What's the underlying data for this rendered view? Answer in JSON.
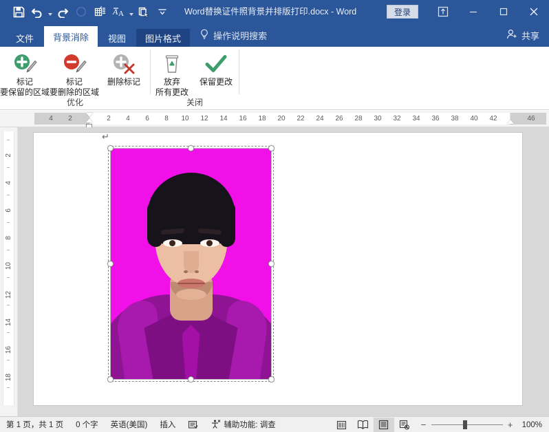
{
  "window": {
    "title": "Word替换证件照背景并排版打印.docx  -  Word",
    "signin_label": "登录",
    "quick_access": [
      {
        "name": "save-icon",
        "label": "保存"
      },
      {
        "name": "undo-icon",
        "label": "撤消"
      },
      {
        "name": "redo-icon",
        "label": "恢复"
      },
      {
        "name": "touch-mode-icon",
        "label": "触摸/鼠标模式"
      },
      {
        "name": "insert-table-icon",
        "label": "插入表格"
      },
      {
        "name": "font-format-icon",
        "label": "字体格式"
      },
      {
        "name": "format-painter-icon",
        "label": "格式刷"
      },
      {
        "name": "customize-qat-icon",
        "label": "自定义快速访问工具栏"
      }
    ],
    "buttons": {
      "ribbon_display": "功能区显示选项",
      "minimize": "最小化",
      "maximize": "最大化",
      "close": "关闭"
    }
  },
  "tabs": [
    {
      "label": "文件",
      "state": "file"
    },
    {
      "label": "背景消除",
      "state": "active"
    },
    {
      "label": "视图",
      "state": "normal"
    },
    {
      "label": "图片格式",
      "state": "highlight"
    }
  ],
  "tellme": {
    "label": "操作说明搜索",
    "icon": "lightbulb-icon"
  },
  "share": {
    "label": "共享",
    "icon": "share-person-icon"
  },
  "ribbon": {
    "groups": [
      {
        "label": "优化",
        "buttons": [
          {
            "icon": "mark-keep-icon",
            "line1": "标记",
            "line2": "要保留的区域"
          },
          {
            "icon": "mark-remove-icon",
            "line1": "标记",
            "line2": "要删除的区域"
          },
          {
            "icon": "delete-mark-icon",
            "line1": "删除标记",
            "line2": ""
          }
        ]
      },
      {
        "label": "关闭",
        "buttons": [
          {
            "icon": "discard-trash-icon",
            "line1": "放弃",
            "line2": "所有更改"
          },
          {
            "icon": "keep-changes-check-icon",
            "line1": "保留更改",
            "line2": ""
          }
        ]
      }
    ]
  },
  "rulers": {
    "corner_label": "L",
    "horizontal": [
      "4",
      "2",
      "2",
      "4",
      "6",
      "8",
      "10",
      "12",
      "14",
      "16",
      "18",
      "20",
      "22",
      "24",
      "26",
      "28",
      "30",
      "32",
      "34",
      "36",
      "38",
      "40",
      "42",
      "46"
    ],
    "vertical": [
      "2",
      "4",
      "6",
      "8",
      "10",
      "12",
      "14",
      "16",
      "18"
    ]
  },
  "document": {
    "picture": {
      "name": "id-photo-background-removal-preview",
      "background_color": "#f210e8",
      "selected": true
    }
  },
  "statusbar": {
    "page_info": "第 1 页，共 1 页",
    "word_count": "0 个字",
    "language": "英语(美国)",
    "insert_mode": "插入",
    "proofing_icon": "proofing-icon",
    "accessibility": "辅助功能: 调查",
    "macro_icon": "macro-recording-icon",
    "views": [
      {
        "icon": "read-mode-icon",
        "label": "阅读视图",
        "active": false
      },
      {
        "icon": "print-layout-icon",
        "label": "页面视图",
        "active": true
      },
      {
        "icon": "web-layout-icon",
        "label": "Web 版式视图",
        "active": false
      }
    ],
    "zoom": {
      "minus": "−",
      "plus": "+",
      "level": "100%"
    }
  },
  "colors": {
    "brand_blue": "#2b579a",
    "magenta": "#f210e8",
    "accent_green": "#3f9c6d",
    "accent_red": "#d13a2d"
  }
}
